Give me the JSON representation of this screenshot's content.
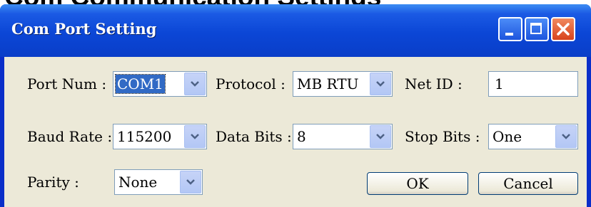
{
  "heading": "Com Communication Settings",
  "window": {
    "title": "Com Port Setting"
  },
  "form": {
    "port_num": {
      "label": "Port Num :",
      "value": "COM1"
    },
    "protocol": {
      "label": "Protocol :",
      "value": "MB RTU"
    },
    "net_id": {
      "label": "Net ID :",
      "value": "1"
    },
    "baud_rate": {
      "label": "Baud Rate :",
      "value": "115200"
    },
    "data_bits": {
      "label": "Data Bits :",
      "value": "8"
    },
    "stop_bits": {
      "label": "Stop Bits :",
      "value": "One"
    },
    "parity": {
      "label": "Parity :",
      "value": "None"
    }
  },
  "buttons": {
    "ok": "OK",
    "cancel": "Cancel"
  },
  "icons": {
    "minimize": "minimize-icon",
    "maximize": "maximize-icon",
    "close": "close-icon",
    "dropdown": "chevron-down-icon"
  },
  "colors": {
    "titlebar": "#0b46d6",
    "client": "#ece9d8",
    "selection": "#316ac5",
    "close_button": "#d8431c"
  }
}
